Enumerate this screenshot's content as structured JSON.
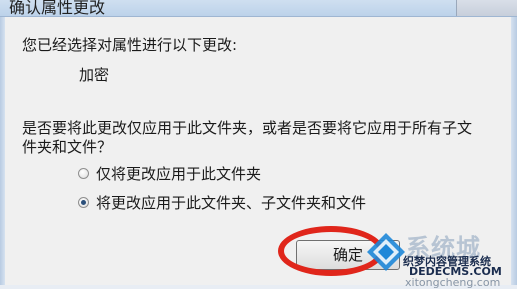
{
  "window": {
    "title": "确认属性更改"
  },
  "dialog": {
    "intro": "您已经选择对属性进行以下更改:",
    "change_item": "加密",
    "question_line1": "是否要将此更改仅应用于此文件夹，或者是否要将它应用于所有子文",
    "question_line2": "件夹和文件？",
    "options": [
      {
        "label": "仅将更改应用于此文件夹",
        "selected": false
      },
      {
        "label": "将更改应用于此文件夹、子文件夹和文件",
        "selected": true
      }
    ],
    "ok_label": "确定"
  },
  "watermark": {
    "brand": "系统城",
    "line1": "织梦内容管理系统",
    "line2": "DEDECMS.COM",
    "line3": "xitongcheng.com"
  },
  "colors": {
    "highlight_ring": "#e0261b",
    "title_bar": "#bcd2ea",
    "dialog_background": "#f0f0f0"
  }
}
